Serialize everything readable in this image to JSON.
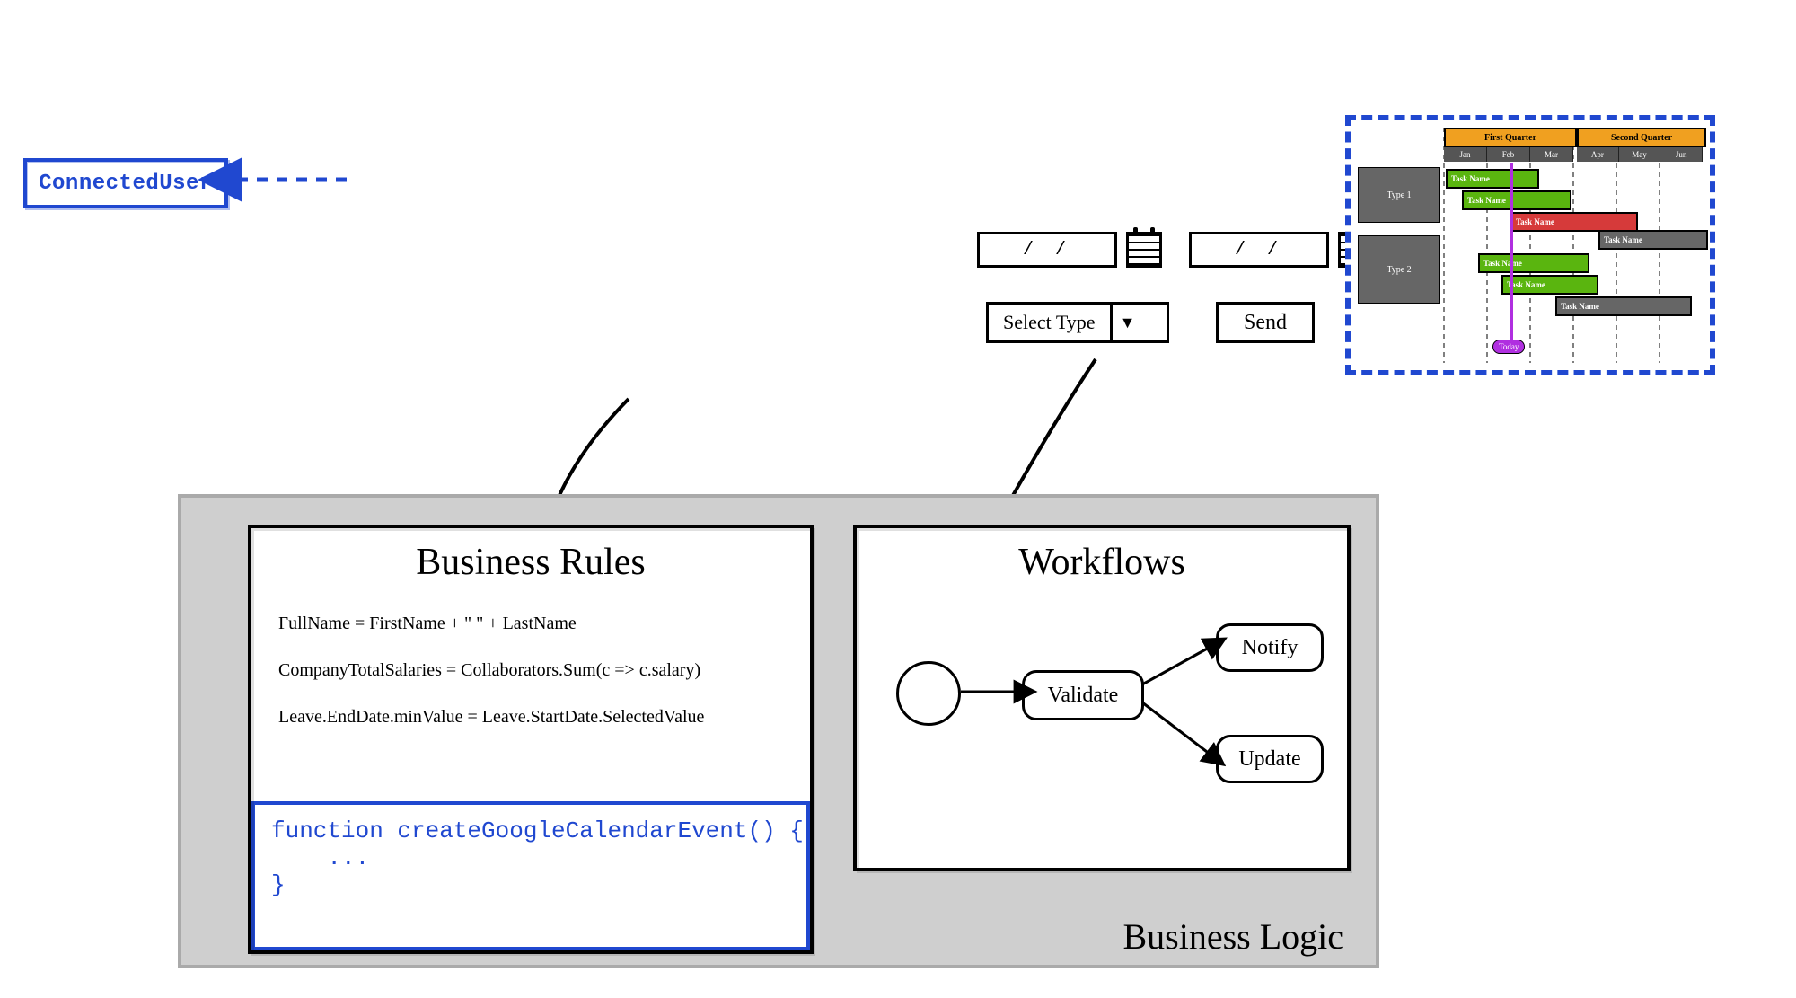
{
  "connected_user_label": "ConnectedUser",
  "form": {
    "date_placeholder": "/ /",
    "select_label": "Select Type",
    "send_label": "Send"
  },
  "gantt": {
    "q1": "First Quarter",
    "q2": "Second Quarter",
    "months_q1": [
      "Jan",
      "Feb",
      "Mar"
    ],
    "months_q2": [
      "Apr",
      "May",
      "Jun"
    ],
    "type1": "Type 1",
    "type2": "Type 2",
    "task": "Task Name",
    "today": "Today"
  },
  "biz": {
    "label": "Business Logic",
    "rules_title": "Business Rules",
    "workflows_title": "Workflows",
    "rule1": "FullName = FirstName + \" \" + LastName",
    "rule2": "CompanyTotalSalaries = Collaborators.Sum(c => c.salary)",
    "rule3": "Leave.EndDate.minValue = Leave.StartDate.SelectedValue",
    "code": "function createGoogleCalendarEvent() {\n    ...\n}",
    "wf_validate": "Validate",
    "wf_notify": "Notify",
    "wf_update": "Update"
  }
}
